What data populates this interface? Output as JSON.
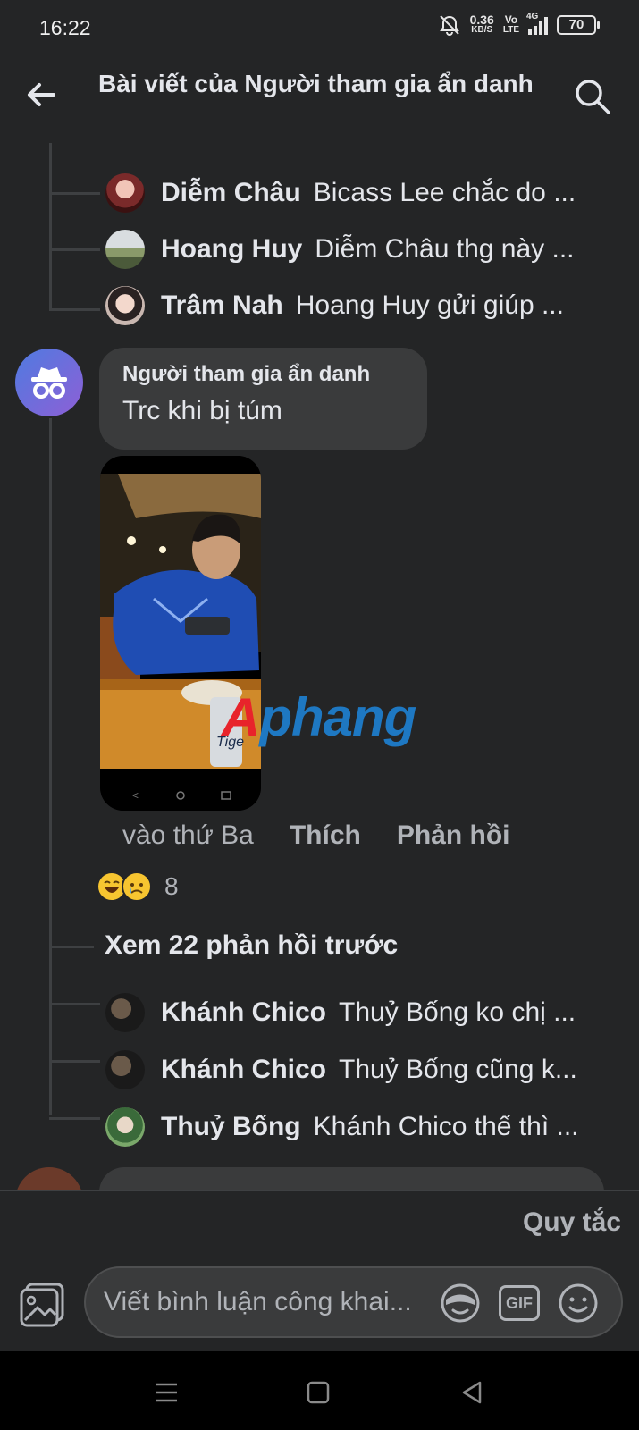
{
  "status_bar": {
    "time": "16:22",
    "net_speed_value": "0.36",
    "net_speed_unit": "KB/S",
    "volte_top": "Vo",
    "volte_bottom": "LTE",
    "network": "4G",
    "battery": "70"
  },
  "header": {
    "title": "Bài viết của Người tham gia ẩn danh",
    "back_icon": "arrow-left-icon",
    "search_icon": "search-icon"
  },
  "thread_top": {
    "replies": [
      {
        "name": "Diễm Châu",
        "text": "Bicass Lee chắc do ..."
      },
      {
        "name": "Hoang Huy",
        "text": "Diễm Châu  thg này ..."
      },
      {
        "name": "Trâm Nah",
        "text": "Hoang Huy gửi giúp ..."
      }
    ]
  },
  "comment": {
    "author": "Người tham gia ẩn danh",
    "text": "Trc khi bị túm",
    "time": "vào thứ Ba",
    "like_label": "Thích",
    "reply_label": "Phản hồi",
    "reaction_count": "8",
    "reactions": [
      "laughing-emoji",
      "sad-emoji"
    ],
    "watermark": "Aphang"
  },
  "thread_bottom": {
    "view_more_label": "Xem 22 phản hồi trước",
    "replies": [
      {
        "name": "Khánh Chico",
        "text": "Thuỷ Bống ko chị ..."
      },
      {
        "name": "Khánh Chico",
        "text": "Thuỷ Bống cũng k..."
      },
      {
        "name": "Thuỷ Bống",
        "text": "Khánh Chico thế thì ..."
      }
    ]
  },
  "composer": {
    "rules_label": "Quy tắc",
    "placeholder": "Viết bình luận công khai...",
    "gif_label": "GIF"
  },
  "colors": {
    "background": "#242526",
    "bubble": "#3a3b3c",
    "text": "#e4e6eb",
    "secondary_text": "#b0b3b8",
    "watermark_red": "#e8242b",
    "watermark_blue": "#1e78c2"
  }
}
